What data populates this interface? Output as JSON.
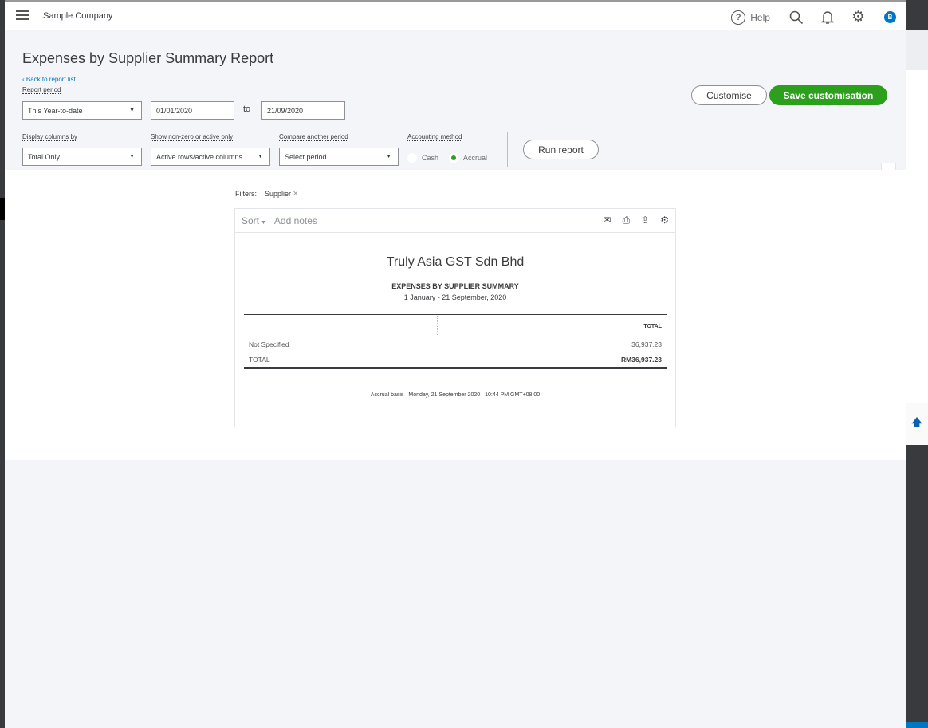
{
  "topbar": {
    "company": "Sample Company",
    "help": "Help",
    "avatar": "B"
  },
  "header": {
    "title": "Expenses by Supplier Summary Report",
    "back": "Back to report list",
    "report_period_label": "Report period",
    "report_period": "This Year-to-date",
    "from_date": "01/01/2020",
    "to_label": "to",
    "to_date": "21/09/2020",
    "display_columns_label": "Display columns by",
    "display_columns": "Total Only",
    "non_zero_label": "Show non-zero or active only",
    "non_zero": "Active rows/active columns",
    "compare_label": "Compare another period",
    "compare": "Select period",
    "accounting_label": "Accounting method",
    "cash": "Cash",
    "accrual": "Accrual",
    "accounting_selected": "Accrual",
    "customise": "Customise",
    "save_customisation": "Save customisation",
    "run_report": "Run report"
  },
  "colors": {
    "accent": "#2ca01c",
    "link": "#0077c5"
  },
  "filters": {
    "label": "Filters:",
    "items": [
      "Supplier"
    ]
  },
  "report": {
    "sort": "Sort",
    "add_notes": "Add notes",
    "company": "Truly Asia GST Sdn Bhd",
    "title": "EXPENSES BY SUPPLIER SUMMARY",
    "dates": "1 January - 21 September, 2020",
    "column": "TOTAL",
    "rows": [
      {
        "name": "Not Specified",
        "value": "36,937.23"
      }
    ],
    "total": {
      "name": "TOTAL",
      "value": "RM36,937.23"
    },
    "footer": {
      "basis": "Accrual basis",
      "datetime": "Monday, 21 September 2020",
      "time": "10:44 PM GMT+08:00"
    }
  }
}
